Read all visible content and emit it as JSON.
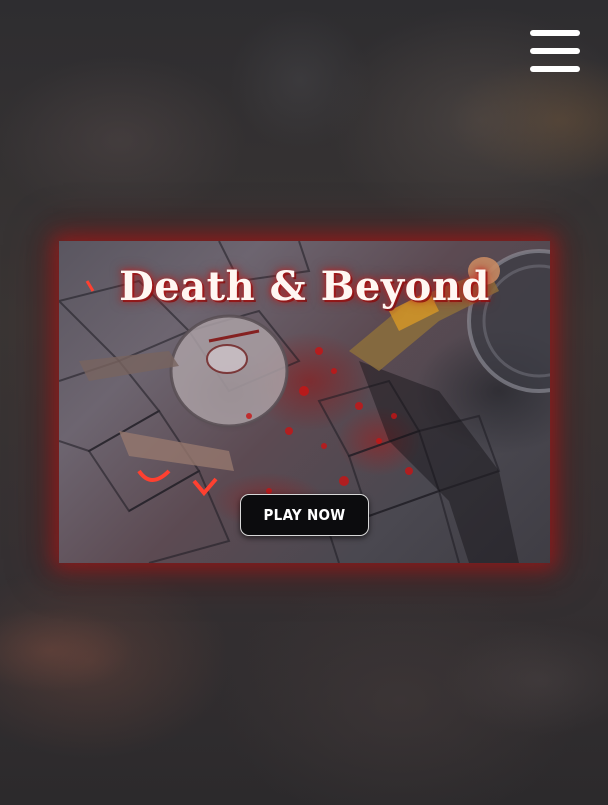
{
  "header": {
    "menu_icon": "hamburger-menu-icon"
  },
  "banner": {
    "title": "Death & Beyond",
    "play_label": "PLAY NOW"
  },
  "colors": {
    "glow": "#be1414",
    "button_bg": "#0c0c0e",
    "button_text": "#ffffff",
    "title_text": "#fff7f2"
  }
}
